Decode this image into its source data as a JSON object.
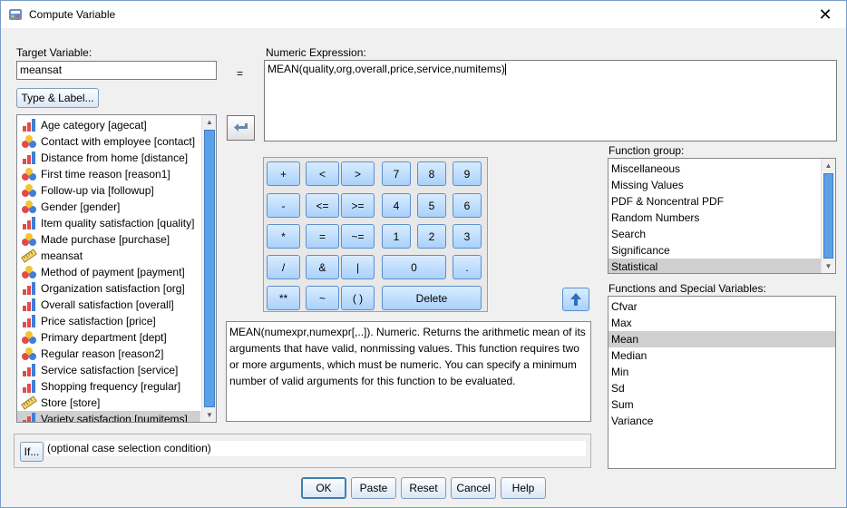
{
  "window": {
    "title": "Compute Variable",
    "close_glyph": "✕"
  },
  "target": {
    "label": "Target Variable:",
    "value": "meansat",
    "type_label_button": "Type & Label..."
  },
  "equals": "=",
  "expression": {
    "label": "Numeric Expression:",
    "value": "MEAN(quality,org,overall,price,service,numitems)"
  },
  "variables": [
    {
      "label": "Age category [agecat]",
      "icon": "ordinal-icon"
    },
    {
      "label": "Contact with employee [contact]",
      "icon": "nominal-icon"
    },
    {
      "label": "Distance from home [distance]",
      "icon": "ordinal-icon"
    },
    {
      "label": "First time reason [reason1]",
      "icon": "nominal-icon"
    },
    {
      "label": "Follow-up via [followup]",
      "icon": "nominal-icon"
    },
    {
      "label": "Gender [gender]",
      "icon": "nominal-icon"
    },
    {
      "label": "Item quality satisfaction [quality]",
      "icon": "ordinal-icon"
    },
    {
      "label": "Made purchase [purchase]",
      "icon": "nominal-icon"
    },
    {
      "label": "meansat",
      "icon": "scale-icon"
    },
    {
      "label": "Method of payment [payment]",
      "icon": "nominal-icon"
    },
    {
      "label": "Organization satisfaction [org]",
      "icon": "ordinal-icon"
    },
    {
      "label": "Overall satisfaction [overall]",
      "icon": "ordinal-icon"
    },
    {
      "label": "Price satisfaction [price]",
      "icon": "ordinal-icon"
    },
    {
      "label": "Primary department [dept]",
      "icon": "nominal-icon"
    },
    {
      "label": "Regular reason [reason2]",
      "icon": "nominal-icon"
    },
    {
      "label": "Service satisfaction [service]",
      "icon": "ordinal-icon"
    },
    {
      "label": "Shopping frequency [regular]",
      "icon": "ordinal-icon"
    },
    {
      "label": "Store [store]",
      "icon": "scale-icon"
    },
    {
      "label": "Variety satisfaction [numitems]",
      "icon": "ordinal-icon"
    }
  ],
  "calculator": {
    "keys": [
      "+",
      "<",
      ">",
      "7",
      "8",
      "9",
      "-",
      "<=",
      ">=",
      "4",
      "5",
      "6",
      "*",
      "=",
      "~=",
      "1",
      "2",
      "3",
      "/",
      "&",
      "|",
      "0",
      ".",
      "**",
      "~",
      "( )",
      "Delete"
    ]
  },
  "description": "MEAN(numexpr,numexpr[,..]). Numeric. Returns the arithmetic mean of its arguments that have valid, nonmissing values. This function requires two or more arguments, which must be numeric. You can specify a minimum number of valid arguments for this function to be evaluated.",
  "function_group": {
    "label": "Function group:",
    "items": [
      "Miscellaneous",
      "Missing Values",
      "PDF & Noncentral PDF",
      "Random Numbers",
      "Search",
      "Significance",
      "Statistical"
    ],
    "selected": "Statistical"
  },
  "functions": {
    "label": "Functions and Special Variables:",
    "items": [
      "Cfvar",
      "Max",
      "Mean",
      "Median",
      "Min",
      "Sd",
      "Sum",
      "Variance"
    ],
    "selected": "Mean"
  },
  "if_panel": {
    "button": "If...",
    "text": "(optional case selection condition)"
  },
  "buttons": {
    "ok": "OK",
    "paste": "Paste",
    "reset": "Reset",
    "cancel": "Cancel",
    "help": "Help"
  },
  "colors": {
    "accent": "#5aa0e6",
    "selection": "#cfcfcf"
  }
}
